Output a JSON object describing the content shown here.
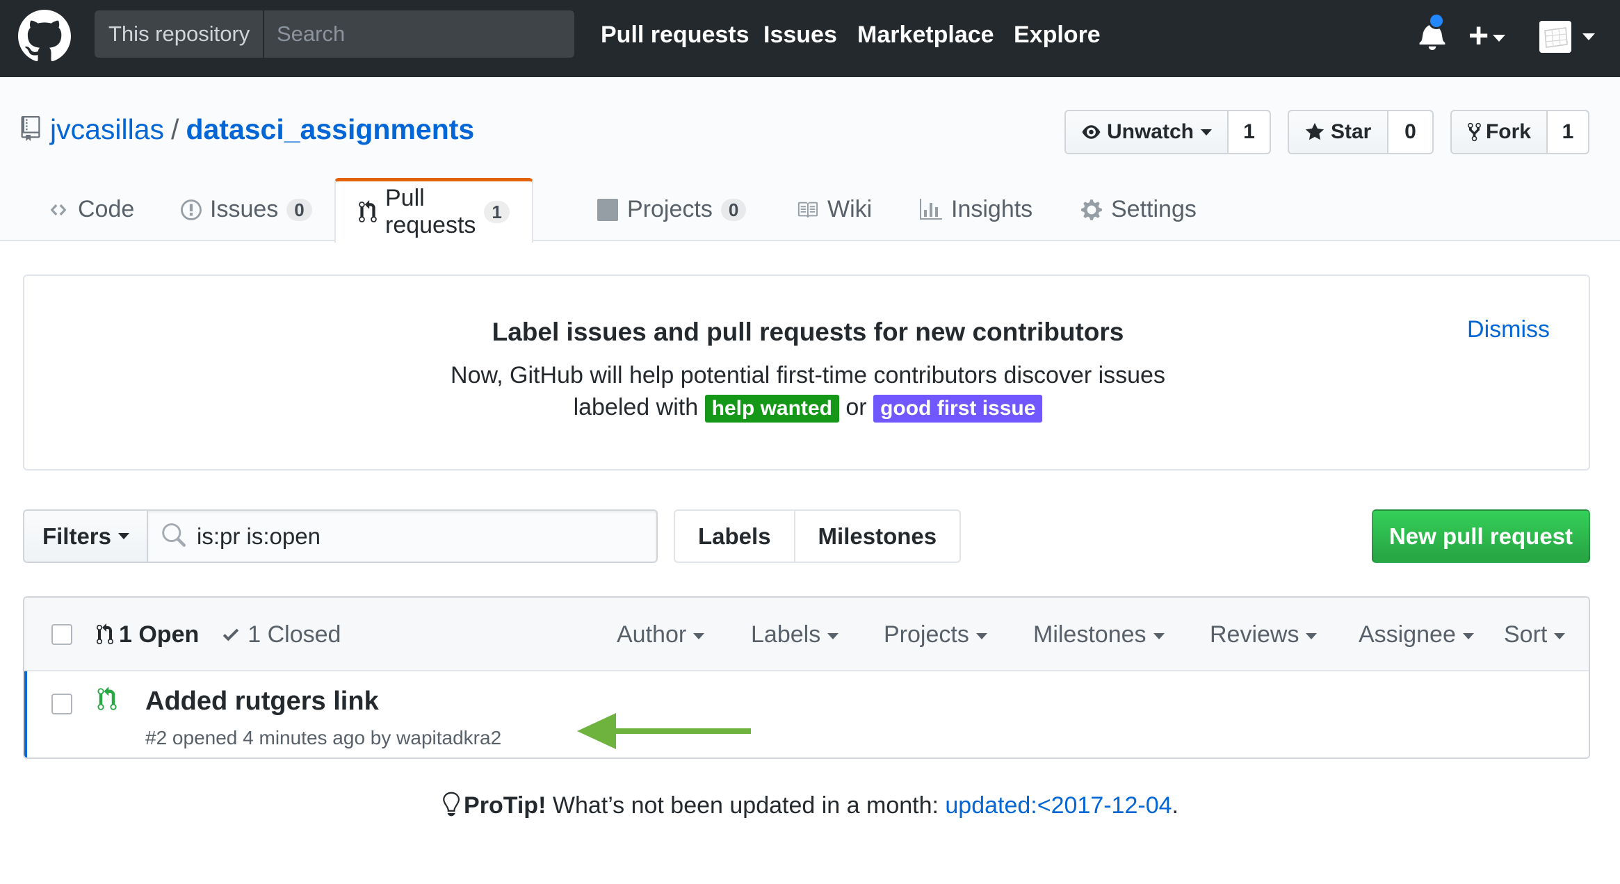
{
  "header": {
    "logo": "github-octocat-icon",
    "search_scope": "This repository",
    "search_placeholder": "Search",
    "nav": [
      "Pull requests",
      "Issues",
      "Marketplace",
      "Explore"
    ],
    "plus_label": "+"
  },
  "repo": {
    "owner": "jvcasillas",
    "separator": "/",
    "name": "datasci_assignments",
    "watch": {
      "label": "Unwatch",
      "count": "1"
    },
    "star": {
      "label": "Star",
      "count": "0"
    },
    "fork": {
      "label": "Fork",
      "count": "1"
    }
  },
  "tabs": [
    {
      "label": "Code",
      "icon": "code-icon"
    },
    {
      "label": "Issues",
      "counter": "0",
      "icon": "issue-opened-icon"
    },
    {
      "label": "Pull requests",
      "counter": "1",
      "icon": "git-pull-request-icon"
    },
    {
      "label": "Projects",
      "counter": "0",
      "icon": "project-icon"
    },
    {
      "label": "Wiki",
      "icon": "book-icon"
    },
    {
      "label": "Insights",
      "icon": "graph-icon"
    },
    {
      "label": "Settings",
      "icon": "gear-icon"
    }
  ],
  "banner": {
    "title": "Label issues and pull requests for new contributors",
    "line1": "Now, GitHub will help potential first-time contributors discover issues",
    "line2_prefix": "labeled with",
    "label_help": "help wanted",
    "label_or": "or",
    "label_good": "good first issue",
    "dismiss": "Dismiss",
    "colors": {
      "help_wanted": "#159818",
      "good_first_issue": "#7057ff"
    }
  },
  "filterbar": {
    "filters_label": "Filters",
    "query": "is:pr is:open",
    "labels": "Labels",
    "milestones": "Milestones",
    "new_pr": "New pull request"
  },
  "list": {
    "open_label": "1 Open",
    "closed_label": "1 Closed",
    "header_filters": [
      "Author",
      "Labels",
      "Projects",
      "Milestones",
      "Reviews",
      "Assignee",
      "Sort"
    ],
    "items": [
      {
        "title": "Added rutgers link",
        "meta": "#2 opened 4 minutes ago by wapitadkra2"
      }
    ]
  },
  "protip": {
    "bold": "ProTip!",
    "text": " What’s not been updated in a month: ",
    "link": "updated:<2017-12-04",
    "end": "."
  },
  "colors": {
    "header_bg": "#24292e",
    "link": "#0366d6",
    "green": "#28a745",
    "tab_accent": "#e36209",
    "arrow": "#6fb33f"
  }
}
